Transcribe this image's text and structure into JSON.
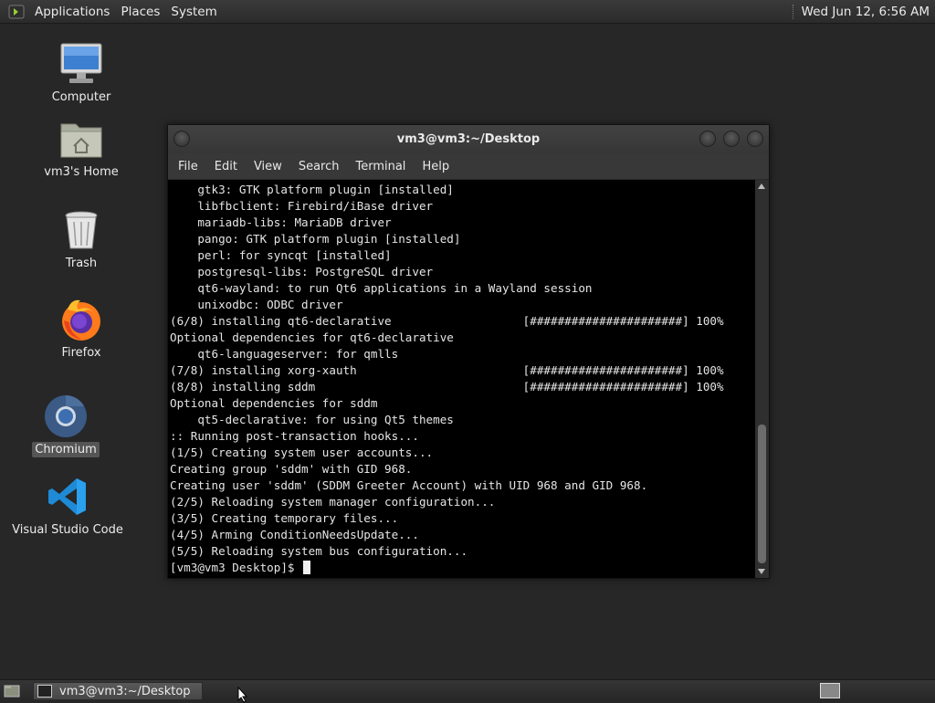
{
  "top_panel": {
    "menus": [
      "Applications",
      "Places",
      "System"
    ],
    "clock": "Wed Jun 12, 6:56 AM"
  },
  "desktop": {
    "icons": [
      {
        "label": "Computer",
        "icon": "computer-icon"
      },
      {
        "label": "vm3's Home",
        "icon": "home-folder-icon"
      },
      {
        "label": "Trash",
        "icon": "trash-icon"
      },
      {
        "label": "Firefox",
        "icon": "firefox-icon"
      },
      {
        "label": "Chromium",
        "icon": "chromium-icon",
        "selected": true
      },
      {
        "label": "Visual Studio Code",
        "icon": "vscode-icon"
      }
    ]
  },
  "terminal": {
    "title": "vm3@vm3:~/Desktop",
    "menu": [
      "File",
      "Edit",
      "View",
      "Search",
      "Terminal",
      "Help"
    ],
    "lines": [
      "    gtk3: GTK platform plugin [installed]",
      "    libfbclient: Firebird/iBase driver",
      "    mariadb-libs: MariaDB driver",
      "    pango: GTK platform plugin [installed]",
      "    perl: for syncqt [installed]",
      "    postgresql-libs: PostgreSQL driver",
      "    qt6-wayland: to run Qt6 applications in a Wayland session",
      "    unixodbc: ODBC driver",
      "(6/8) installing qt6-declarative                   [######################] 100%",
      "Optional dependencies for qt6-declarative",
      "    qt6-languageserver: for qmlls",
      "(7/8) installing xorg-xauth                        [######################] 100%",
      "(8/8) installing sddm                              [######################] 100%",
      "Optional dependencies for sddm",
      "    qt5-declarative: for using Qt5 themes",
      ":: Running post-transaction hooks...",
      "(1/5) Creating system user accounts...",
      "Creating group 'sddm' with GID 968.",
      "Creating user 'sddm' (SDDM Greeter Account) with UID 968 and GID 968.",
      "(2/5) Reloading system manager configuration...",
      "(3/5) Creating temporary files...",
      "(4/5) Arming ConditionNeedsUpdate...",
      "(5/5) Reloading system bus configuration..."
    ],
    "prompt": "[vm3@vm3 Desktop]$ "
  },
  "bottom_panel": {
    "task_label": "vm3@vm3:~/Desktop"
  }
}
